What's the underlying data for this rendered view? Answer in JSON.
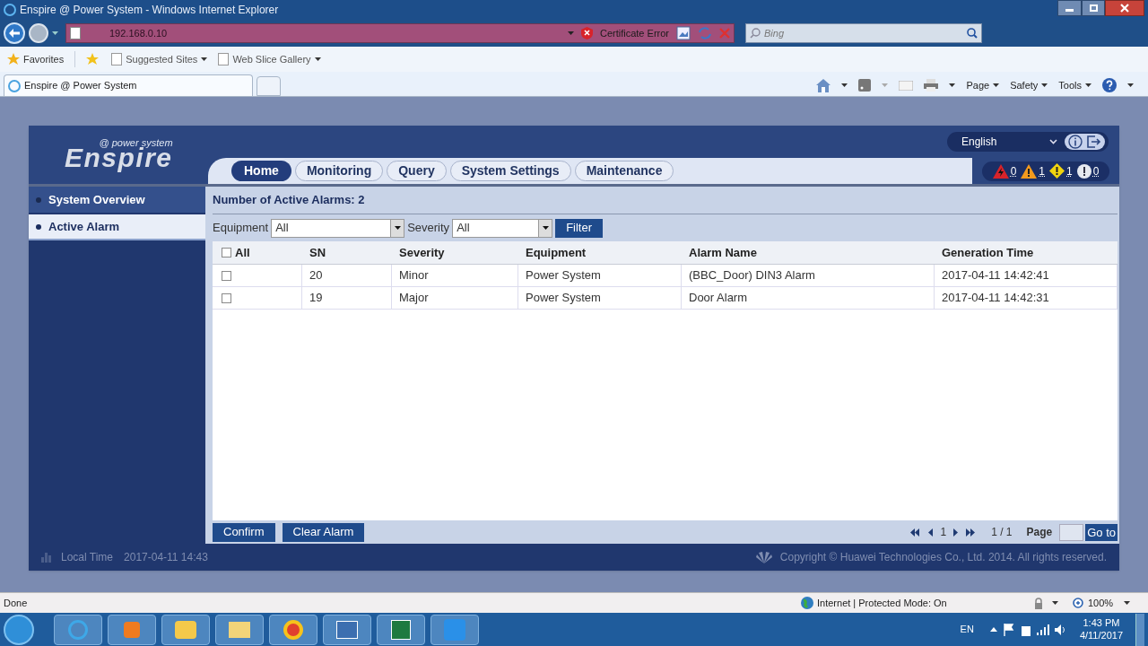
{
  "browser": {
    "title": "Enspire @ Power System - Windows Internet Explorer",
    "address": "192.168.0.10",
    "cert_error": "Certificate Error",
    "search_placeholder": "Bing",
    "favorites": "Favorites",
    "fav_links": [
      "Suggested Sites",
      "Web Slice Gallery"
    ],
    "tab_title": "Enspire @ Power System",
    "commands": [
      "Page",
      "Safety",
      "Tools"
    ]
  },
  "app": {
    "logo": "Enspire",
    "logo_sub": "@ power system",
    "language": "English",
    "nav": [
      {
        "label": "Home",
        "selected": true
      },
      {
        "label": "Monitoring",
        "selected": false
      },
      {
        "label": "Query",
        "selected": false
      },
      {
        "label": "System Settings",
        "selected": false
      },
      {
        "label": "Maintenance",
        "selected": false
      }
    ],
    "alarm_counts": [
      {
        "kind": "critical",
        "count": "0"
      },
      {
        "kind": "major",
        "count": "1"
      },
      {
        "kind": "minor",
        "count": "1"
      },
      {
        "kind": "warning",
        "count": "0"
      }
    ],
    "sidebar": [
      {
        "label": "System Overview",
        "selected": false
      },
      {
        "label": "Active Alarm",
        "selected": true
      }
    ],
    "heading": "Number of Active Alarms: 2",
    "filters": {
      "equipment_label": "Equipment",
      "equipment_value": "All",
      "severity_label": "Severity",
      "severity_value": "All",
      "button": "Filter"
    },
    "select_all": {
      "label": "All",
      "checked": false
    },
    "columns": [
      "SN",
      "Severity",
      "Equipment",
      "Alarm Name",
      "Generation Time"
    ],
    "rows": [
      {
        "checked": false,
        "cells": [
          "20",
          "Minor",
          "Power System",
          "(BBC_Door) DIN3 Alarm",
          "2017-04-11 14:42:41"
        ]
      },
      {
        "checked": false,
        "cells": [
          "19",
          "Major",
          "Power System",
          "Door Alarm",
          "2017-04-11 14:42:31"
        ]
      }
    ],
    "buttons": [
      "Confirm",
      "Clear Alarm"
    ],
    "pager": {
      "current": "1",
      "count": "1 / 1",
      "label": "Page",
      "go": "Go to"
    },
    "local_time_label": "Local Time",
    "local_time": "2017-04-11 14:43",
    "copyright": "Copyright © Huawei Technologies Co., Ltd. 2014. All rights reserved."
  },
  "status_bar": {
    "status": "Done",
    "zone": "Internet | Protected Mode: On",
    "zoom": "100%"
  },
  "taskbar": {
    "language": "EN",
    "time": "1:43 PM",
    "date": "4/11/2017"
  }
}
